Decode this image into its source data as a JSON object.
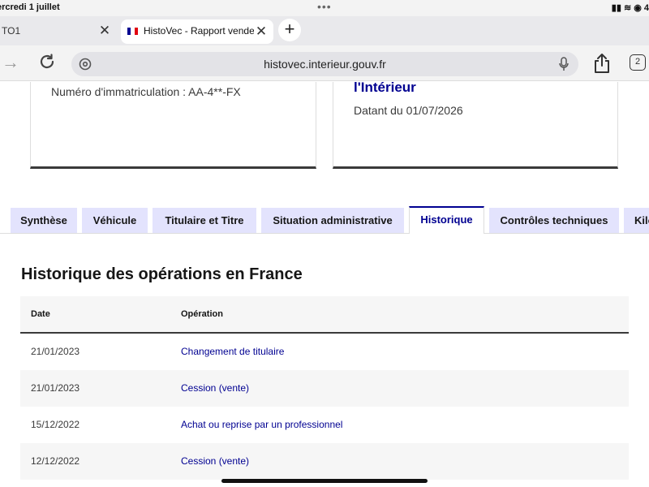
{
  "status_bar": {
    "date": "ercredi 1 juillet",
    "dots": "•••",
    "right": "▮▮ ≋ ◉ 4"
  },
  "browser_tabs": [
    {
      "label": "TO1",
      "close": "✕"
    },
    {
      "label": "HistoVec - Rapport vendeur",
      "close": "✕"
    }
  ],
  "new_tab_label": "+",
  "flag_colors": [
    "#000091",
    "#ffffff",
    "#e1000f"
  ],
  "url": "histovec.interieur.gouv.fr",
  "tabs_count": "2",
  "cards": {
    "immatriculation": "Numéro d'immatriculation : AA-4**-FX",
    "ministry": "l'Intérieur",
    "datant": "Datant du 01/07/2026"
  },
  "tabs": [
    {
      "label": "Synthèse"
    },
    {
      "label": "Véhicule"
    },
    {
      "label": "Titulaire et Titre"
    },
    {
      "label": "Situation administrative"
    },
    {
      "label": "Historique"
    },
    {
      "label": "Contrôles techniques"
    },
    {
      "label": "Kilo"
    }
  ],
  "section_title": "Historique des opérations en France",
  "table": {
    "headers": {
      "date": "Date",
      "operation": "Opération"
    },
    "rows": [
      {
        "date": "21/01/2023",
        "operation": "Changement de titulaire"
      },
      {
        "date": "21/01/2023",
        "operation": "Cession (vente)"
      },
      {
        "date": "15/12/2022",
        "operation": "Achat ou reprise par un professionnel"
      },
      {
        "date": "12/12/2022",
        "operation": "Cession (vente)"
      }
    ]
  },
  "colors": {
    "accent": "#000091",
    "tab_bg": "#e3e3fd",
    "text": "#161616"
  }
}
